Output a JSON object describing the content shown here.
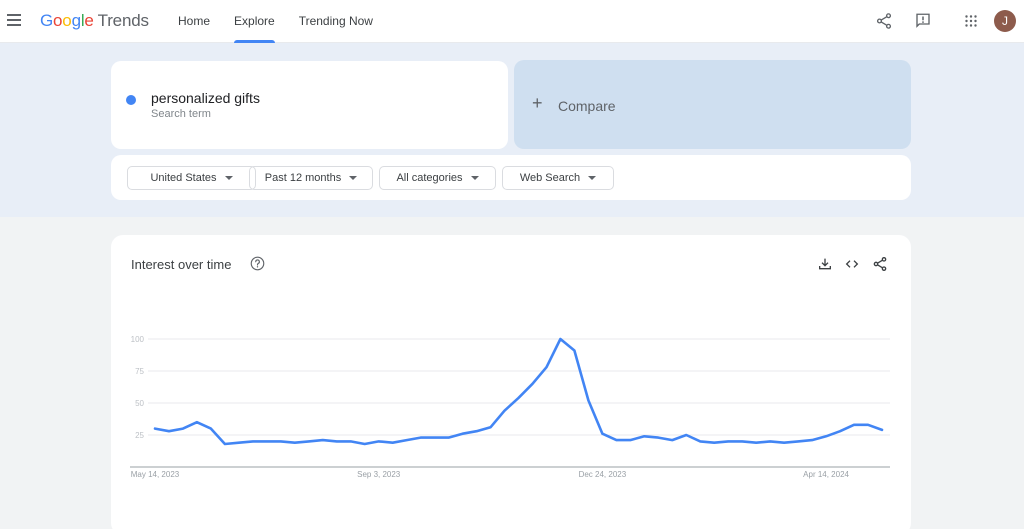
{
  "header": {
    "logo_letters": [
      "G",
      "o",
      "o",
      "g",
      "l",
      "e"
    ],
    "product": "Trends",
    "nav": [
      {
        "label": "Home",
        "active": false
      },
      {
        "label": "Explore",
        "active": true
      },
      {
        "label": "Trending Now",
        "active": false
      }
    ],
    "icons": [
      "menu-icon",
      "share-icon",
      "feedback-icon",
      "apps-icon"
    ],
    "avatar_initial": "J",
    "accent_color": "#4285f4"
  },
  "search": {
    "term": "personalized gifts",
    "term_subtitle": "Search term",
    "term_color": "#4285f4",
    "compare_label": "Compare",
    "compare_icon": "plus-icon"
  },
  "filters": [
    {
      "label": "United States"
    },
    {
      "label": "Past 12 months"
    },
    {
      "label": "All categories"
    },
    {
      "label": "Web Search"
    }
  ],
  "chart_card": {
    "title": "Interest over time",
    "actions": [
      "download-icon",
      "embed-icon",
      "share-icon"
    ]
  },
  "chart_data": {
    "type": "line",
    "title": "Interest over time",
    "xlabel": "",
    "ylabel": "",
    "ylim": [
      0,
      100
    ],
    "yticks": [
      25,
      50,
      75,
      100
    ],
    "grid": true,
    "x_tick_labels": [
      {
        "index": 0,
        "label": "May 14, 2023"
      },
      {
        "index": 16,
        "label": "Sep 3, 2023"
      },
      {
        "index": 32,
        "label": "Dec 24, 2023"
      },
      {
        "index": 48,
        "label": "Apr 14, 2024"
      }
    ],
    "series": [
      {
        "name": "personalized gifts",
        "color": "#4285f4",
        "values": [
          30,
          28,
          30,
          35,
          30,
          18,
          19,
          20,
          20,
          20,
          19,
          20,
          21,
          20,
          20,
          18,
          20,
          19,
          21,
          23,
          23,
          23,
          26,
          28,
          31,
          44,
          54,
          65,
          78,
          100,
          91,
          52,
          26,
          21,
          21,
          24,
          23,
          21,
          25,
          20,
          19,
          20,
          20,
          19,
          20,
          19,
          20,
          21,
          24,
          28,
          33,
          33,
          29
        ]
      }
    ]
  }
}
